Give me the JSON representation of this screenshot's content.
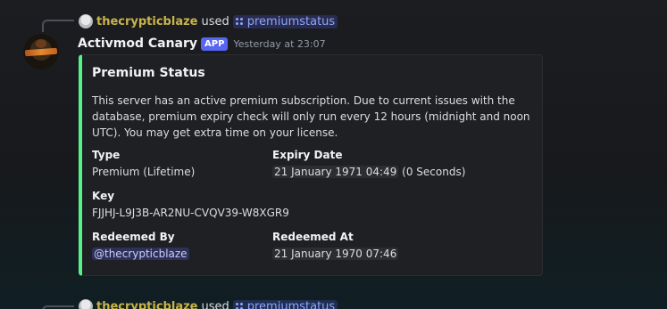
{
  "message1": {
    "reply": {
      "username": "thecrypticblaze",
      "used_text": "used",
      "command": "premiumstatus"
    },
    "author": {
      "name": "Activmod Canary",
      "badge": "APP",
      "timestamp": "Yesterday at 23:07"
    },
    "embed": {
      "accent_color": "#57f287",
      "title": "Premium Status",
      "description": "This server has an active premium subscription. Due to current issues with the database, premium expiry check will only run every 12 hours (midnight and noon UTC). You may get extra time on your license.",
      "fields": {
        "type": {
          "name": "Type",
          "value": "Premium (Lifetime)"
        },
        "expiry": {
          "name": "Expiry Date",
          "timestamp": "21 January 1971 04:49",
          "suffix": "(0 Seconds)"
        },
        "key": {
          "name": "Key",
          "value": "FJJHJ-L9J3B-AR2NU-CVQV39-W8XGR9"
        },
        "redeemed_by": {
          "name": "Redeemed By",
          "mention": "@thecrypticblaze"
        },
        "redeemed_at": {
          "name": "Redeemed At",
          "timestamp": "21 January 1970 07:46"
        }
      }
    }
  },
  "message2": {
    "reply": {
      "username": "thecrypticblaze",
      "used_text": "used",
      "command": "premiumstatus"
    }
  }
}
